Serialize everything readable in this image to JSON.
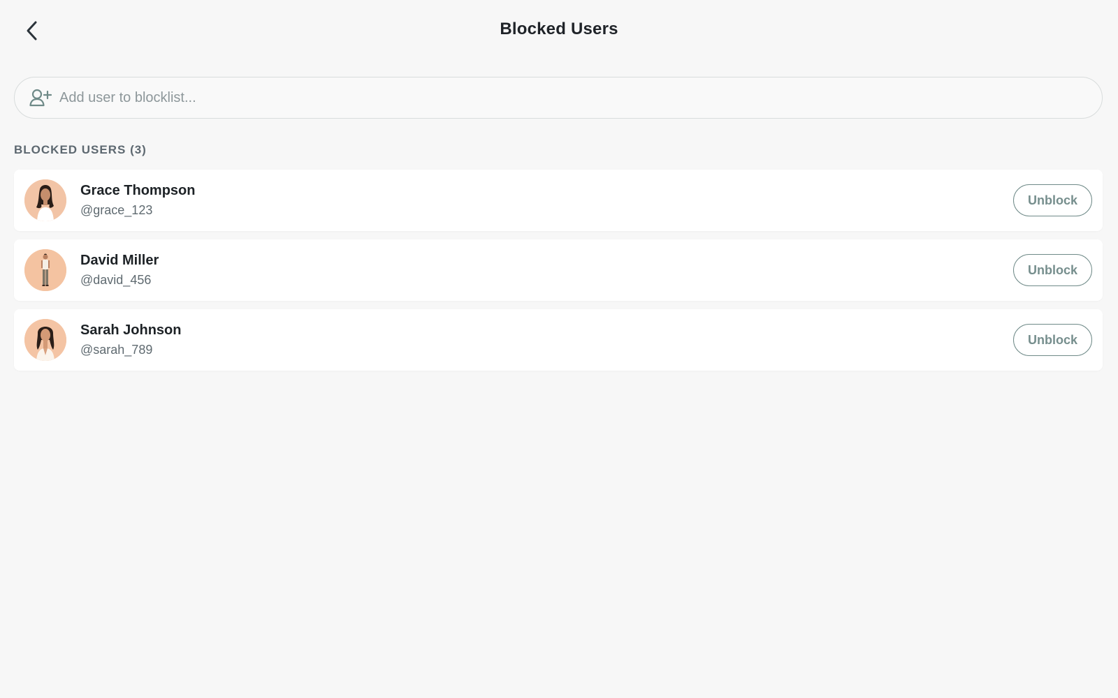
{
  "header": {
    "title": "Blocked Users",
    "back_icon": "chevron-left-icon"
  },
  "search": {
    "placeholder": "Add user to blocklist...",
    "value": "",
    "icon": "add-user-icon"
  },
  "section": {
    "label": "BLOCKED USERS (3)"
  },
  "users": [
    {
      "name": "Grace Thompson",
      "handle": "@grace_123",
      "action_label": "Unblock"
    },
    {
      "name": "David Miller",
      "handle": "@david_456",
      "action_label": "Unblock"
    },
    {
      "name": "Sarah Johnson",
      "handle": "@sarah_789",
      "action_label": "Unblock"
    }
  ],
  "colors": {
    "background": "#f7f7f7",
    "card": "#ffffff",
    "accent": "#768e8d",
    "avatar_bg": "#f4c3a1"
  }
}
